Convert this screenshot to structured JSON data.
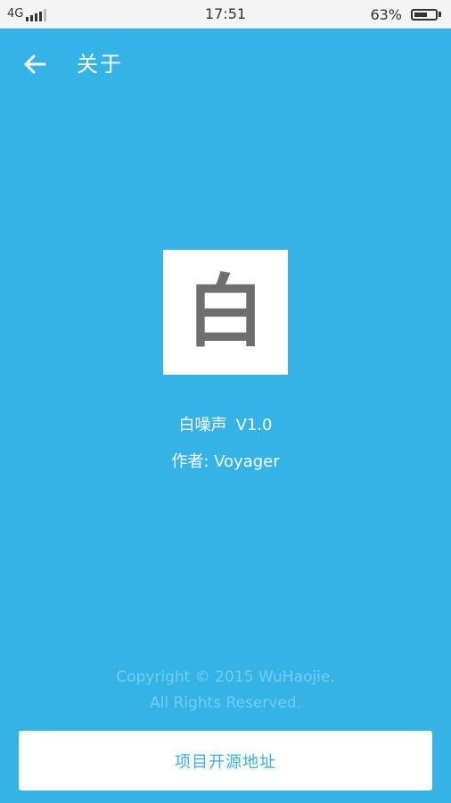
{
  "status_bar": {
    "network": "4G",
    "time": "17:51",
    "battery_percent": "63%",
    "battery_level": 0.63,
    "signal_bars": 5,
    "signal_bars_active": 4
  },
  "toolbar": {
    "back_icon": "arrow-left-icon",
    "title": "关于"
  },
  "logo": {
    "glyph": "白"
  },
  "app_info": {
    "name": "白噪声",
    "version": "V1.0",
    "author": "作者: Voyager"
  },
  "footer": {
    "copyright_line1": "Copyright © 2015 WuHaojie.",
    "copyright_line2": "All Rights Reserved.",
    "open_source_label": "项目开源地址"
  },
  "colors": {
    "background": "#34B4E6",
    "logo_glyph": "#6E6E6E",
    "button_text": "#34B4E6"
  }
}
